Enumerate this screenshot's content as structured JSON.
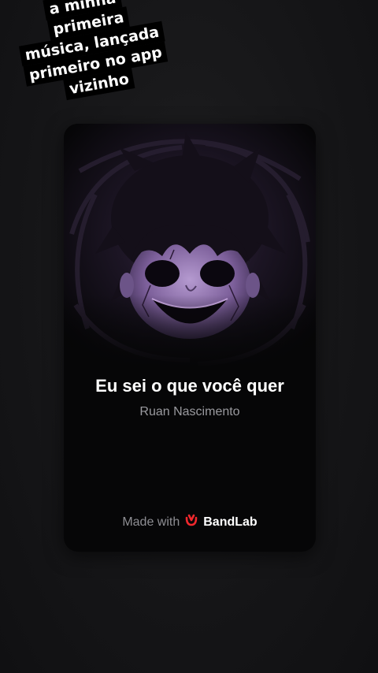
{
  "caption": {
    "lines": [
      "a minha primeira",
      "música, lançada",
      "primeiro no app",
      "vizinho"
    ]
  },
  "card": {
    "title": "Eu sei o que você quer",
    "artist": "Ruan Nascimento",
    "footer": {
      "made_with": "Made with",
      "brand": "BandLab",
      "logo_icon": "bandlab-logo-icon",
      "brand_color": "#f0282d"
    }
  }
}
